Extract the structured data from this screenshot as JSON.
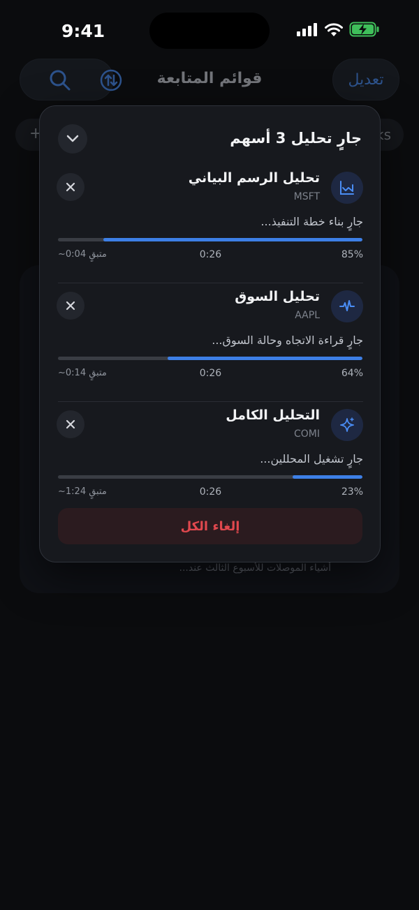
{
  "status_bar": {
    "time": "9:41"
  },
  "background": {
    "title": "قوائم المتابعة",
    "edit_label": "تعديل",
    "chip_left": "+",
    "chip_right": "ks",
    "news_snippet": "أشياء الموصلات للأسبوع الثالث عند..."
  },
  "panel": {
    "title": "جارٍ تحليل 3 أسهم",
    "cancel_all_label": "إلغاء الكل",
    "tasks": [
      {
        "name": "تحليل الرسم البياني",
        "ticker": "MSFT",
        "icon": "chart-icon",
        "status": "جارٍ بناء خطة التنفيذ...",
        "progress": 85,
        "percent_label": "85%",
        "elapsed": "0:26",
        "remaining": "~0:04 متبقٍ"
      },
      {
        "name": "تحليل السوق",
        "ticker": "AAPL",
        "icon": "pulse-icon",
        "status": "جارٍ قراءة الاتجاه وحالة السوق...",
        "progress": 64,
        "percent_label": "64%",
        "elapsed": "0:26",
        "remaining": "~0:14 متبقٍ"
      },
      {
        "name": "التحليل الكامل",
        "ticker": "COMI",
        "icon": "sparkle-icon",
        "status": "جارٍ تشغيل المحللين...",
        "progress": 23,
        "percent_label": "23%",
        "elapsed": "0:26",
        "remaining": "~1:24 متبقٍ"
      }
    ]
  },
  "colors": {
    "accent": "#3d7fe6",
    "danger": "#e0484e",
    "panel_bg": "#17191e"
  }
}
